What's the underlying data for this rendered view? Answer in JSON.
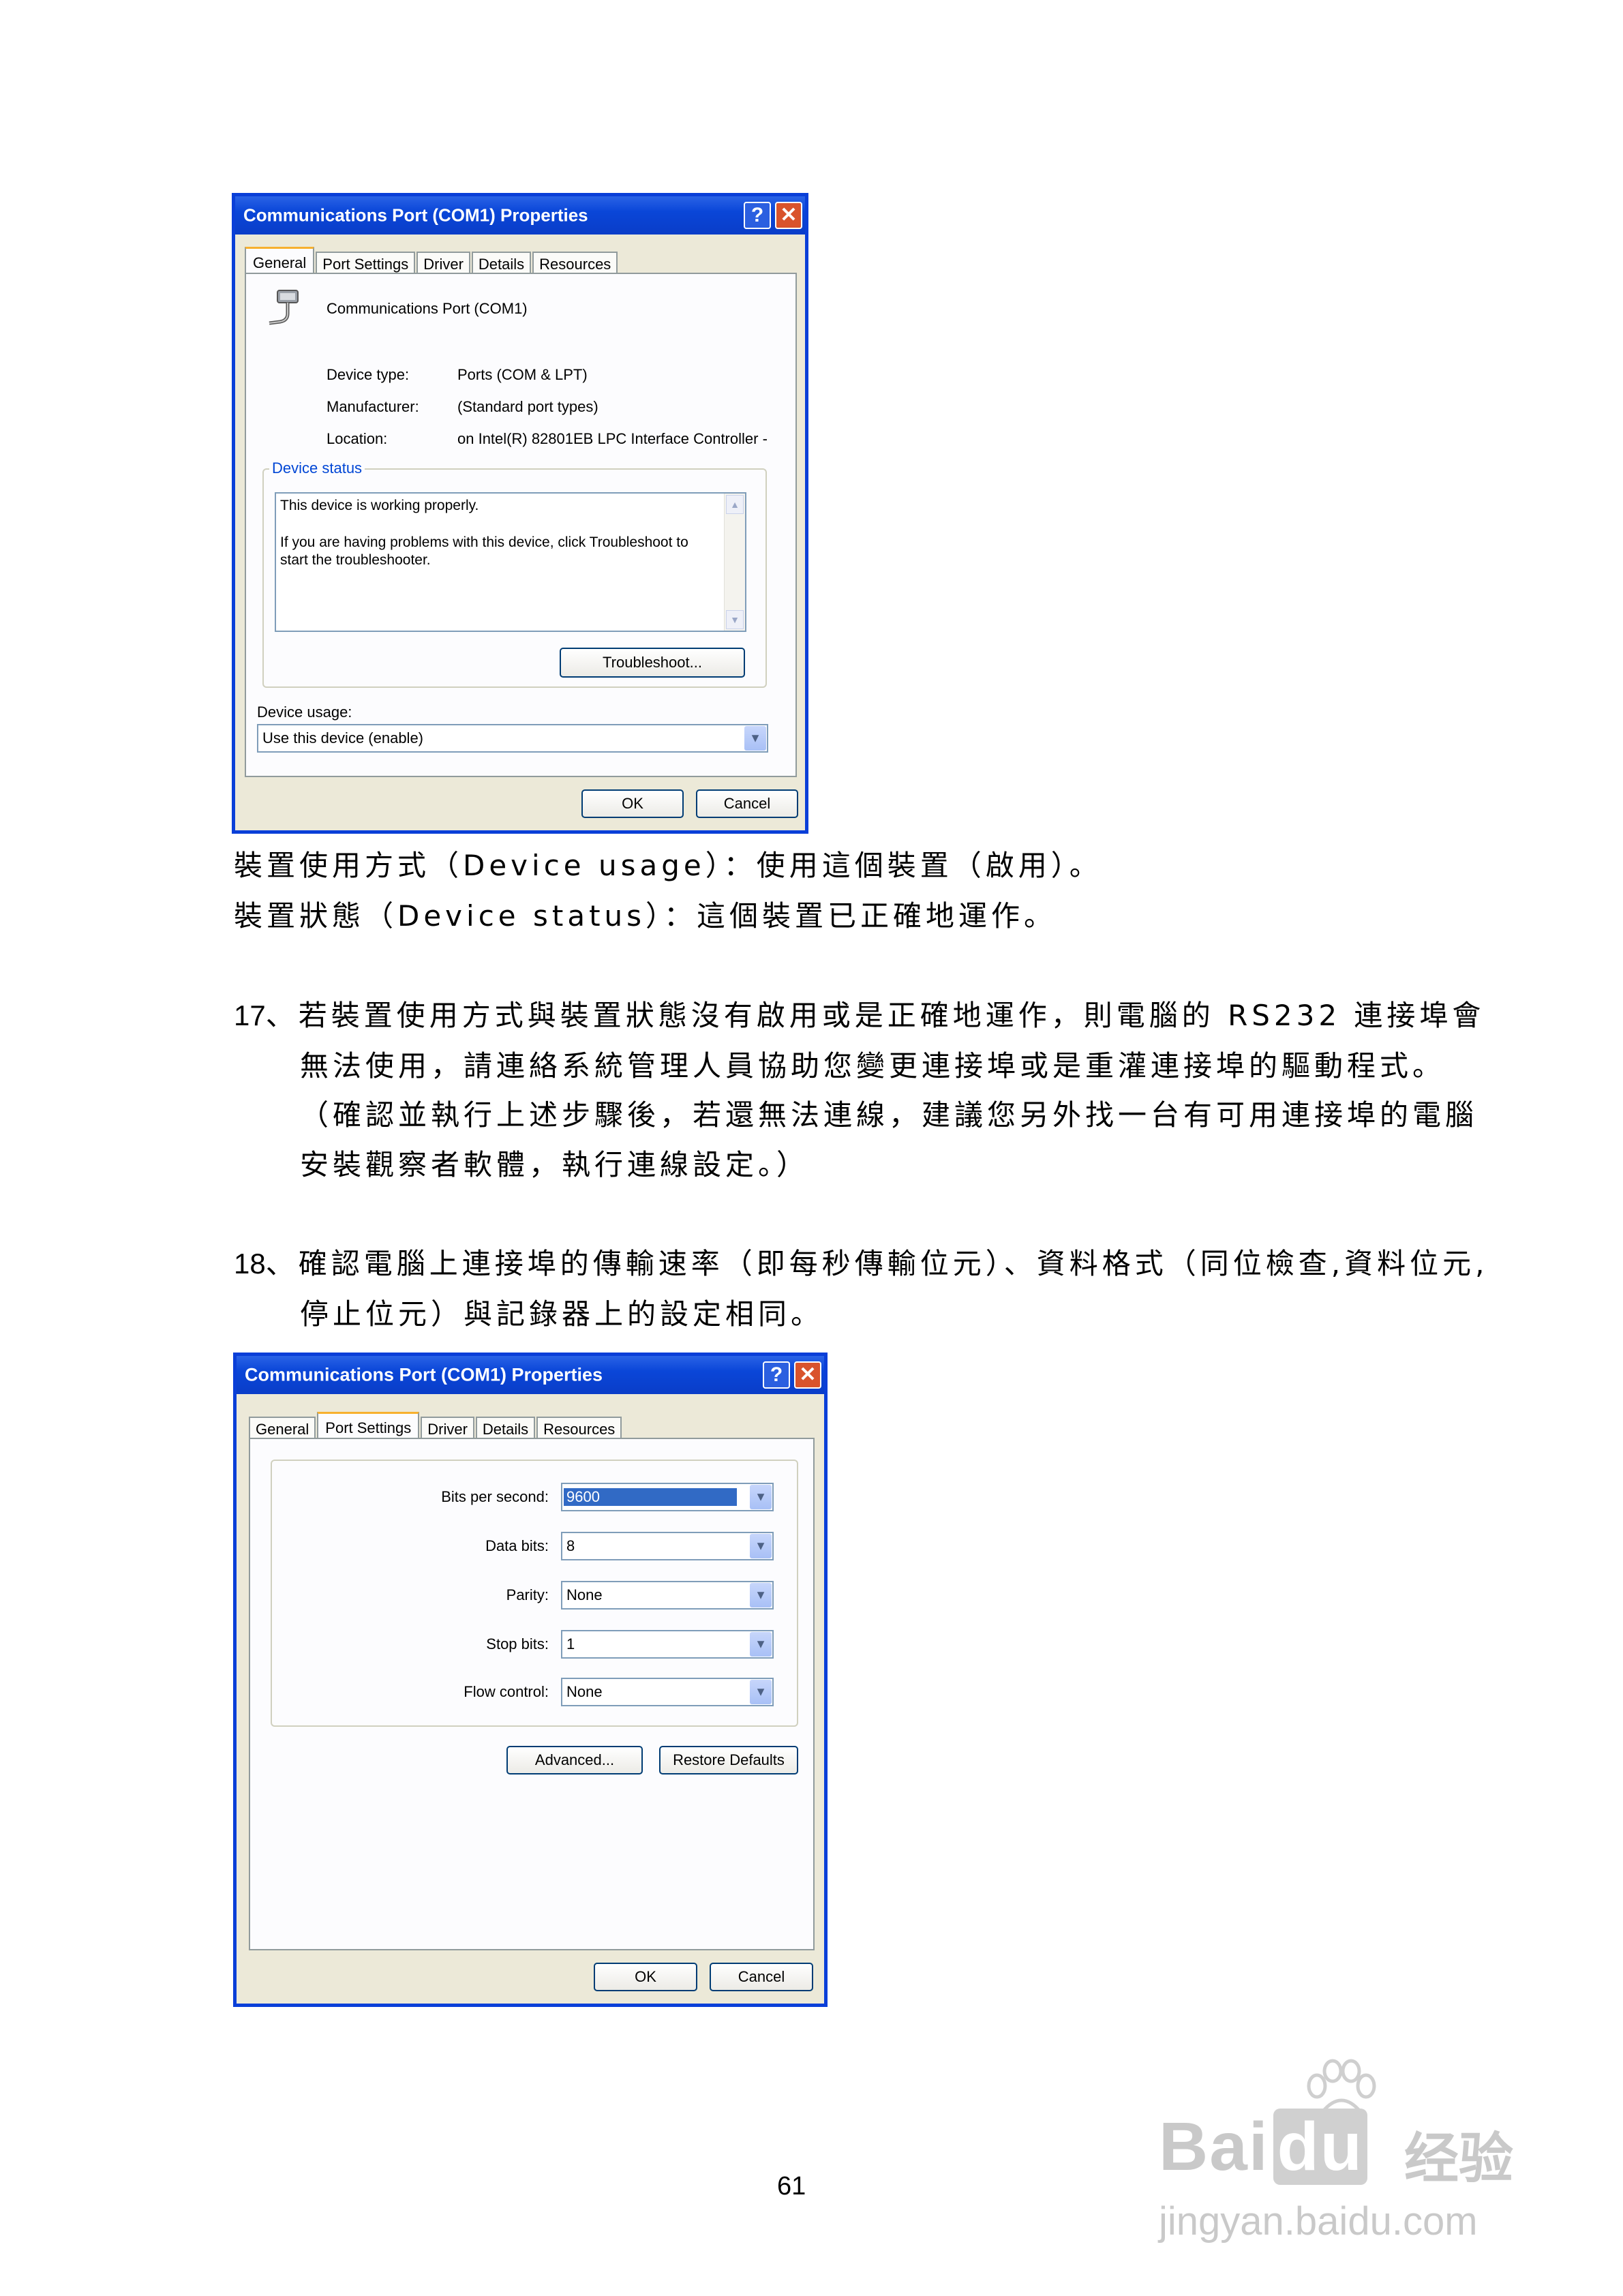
{
  "dialog1": {
    "title": "Communications Port (COM1) Properties",
    "help_glyph": "?",
    "close_glyph": "✕",
    "tabs": [
      "General",
      "Port Settings",
      "Driver",
      "Details",
      "Resources"
    ],
    "active_tab": "General",
    "device_name": "Communications Port (COM1)",
    "device_type_label": "Device type:",
    "device_type_value": "Ports (COM & LPT)",
    "manufacturer_label": "Manufacturer:",
    "manufacturer_value": "(Standard port types)",
    "location_label": "Location:",
    "location_value": "on Intel(R) 82801EB LPC Interface Controller -",
    "device_status_title": "Device status",
    "status_line1": "This device is working properly.",
    "status_line2": "If you are having problems with this device, click Troubleshoot to",
    "status_line3": "start the troubleshooter.",
    "troubleshoot_button": "Troubleshoot...",
    "device_usage_label": "Device usage:",
    "device_usage_value": "Use this device (enable)",
    "ok_button": "OK",
    "cancel_button": "Cancel"
  },
  "text": {
    "usage_line": "裝置使用方式（Device usage）：使用這個裝置（啟用）。",
    "status_line": "裝置狀態（Device status）：這個裝置已正確地運作。",
    "step17_num": "17",
    "step17_line1": "、若裝置使用方式與裝置狀態沒有啟用或是正確地運作，則電腦的 RS232 連接埠會",
    "step17_line2": "無法使用，請連絡系統管理人員協助您變更連接埠或是重灌連接埠的驅動程式。",
    "step17_line3": "（確認並執行上述步驟後，若還無法連線，建議您另外找一台有可用連接埠的電腦",
    "step17_line4": "安裝觀察者軟體，執行連線設定。）",
    "step18_num": "18",
    "step18_line1": "、確認電腦上連接埠的傳輸速率（即每秒傳輸位元）、資料格式（同位檢查,資料位元,",
    "step18_line2": "停止位元）與記錄器上的設定相同。"
  },
  "dialog2": {
    "title": "Communications Port (COM1) Properties",
    "help_glyph": "?",
    "close_glyph": "✕",
    "tabs": [
      "General",
      "Port Settings",
      "Driver",
      "Details",
      "Resources"
    ],
    "active_tab": "Port Settings",
    "bits_label": "Bits per second:",
    "bits_value": "9600",
    "databits_label": "Data bits:",
    "databits_value": "8",
    "parity_label": "Parity:",
    "parity_value": "None",
    "stopbits_label": "Stop bits:",
    "stopbits_value": "1",
    "flow_label": "Flow control:",
    "flow_value": "None",
    "advanced_button": "Advanced...",
    "restore_button": "Restore Defaults",
    "ok_button": "OK",
    "cancel_button": "Cancel"
  },
  "page_number": "61",
  "watermark": {
    "brand": "Bai",
    "brand2": "du",
    "cn": "经验",
    "url": "jingyan.baidu.com"
  }
}
